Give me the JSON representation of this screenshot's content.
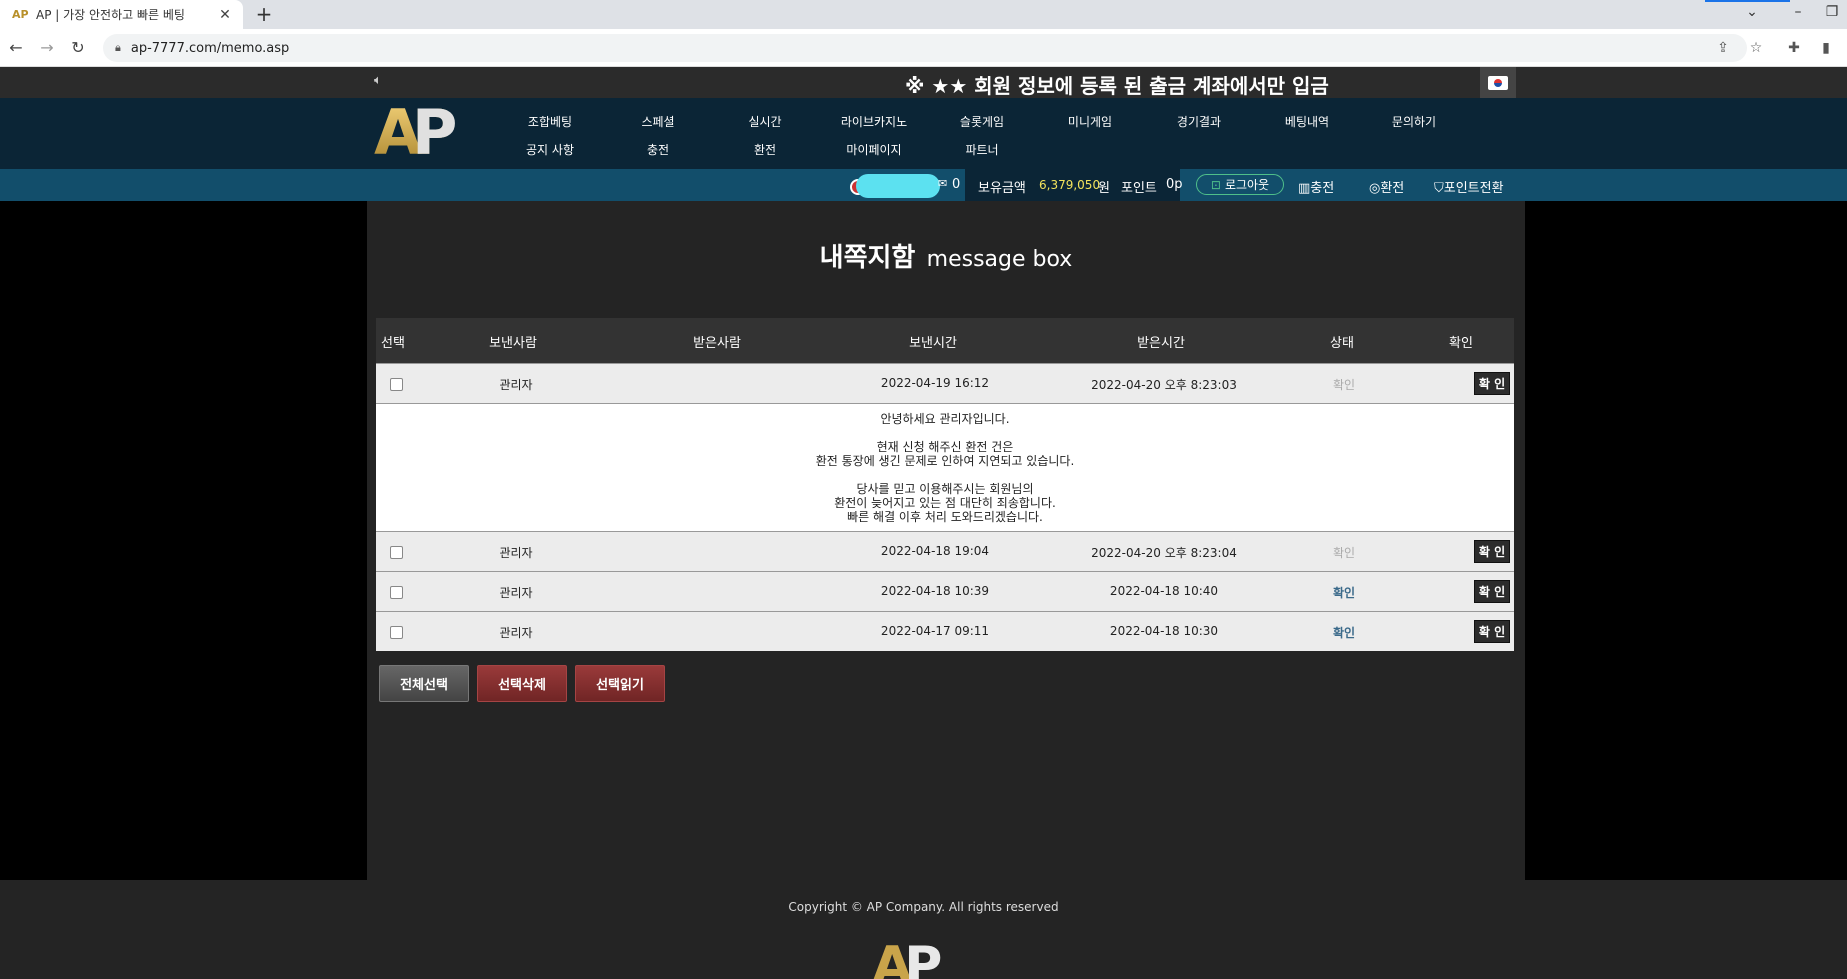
{
  "browser": {
    "tab_title": "AP | 가장 안전하고 빠른 베팅",
    "tab_close": "✕",
    "new_tab": "+",
    "url": "ap-7777.com/memo.asp"
  },
  "notice": {
    "text": "※ ★★ 회원 정보에 등록 된 출금 계좌에서만 입금"
  },
  "brand": {
    "logo_a": "A",
    "logo_p": "P"
  },
  "menu": {
    "row1": [
      "조합베팅",
      "스페셜",
      "실시간",
      "라이브카지노",
      "슬롯게임",
      "미니게임",
      "경기결과",
      "베팅내역",
      "문의하기"
    ],
    "row2": [
      "공지 사항",
      "충전",
      "환전",
      "마이페이지",
      "파트너"
    ]
  },
  "userbar": {
    "message_count": "0",
    "balance_label": "보유금액",
    "balance_value": "6,379,050",
    "balance_unit": "원",
    "point_label": "포인트",
    "point_value": "0p",
    "logout": "로그아웃",
    "deposit": "충전",
    "withdraw": "환전",
    "point_convert": "포인트전환"
  },
  "page": {
    "title_ko": "내쪽지함",
    "title_en": "message box"
  },
  "table": {
    "headers": [
      "선택",
      "보낸사람",
      "받은사람",
      "보낸시간",
      "받은시간",
      "상태",
      "확인"
    ],
    "rows": [
      {
        "sender": "관리자",
        "receiver": "",
        "sent": "2022-04-19 16:12",
        "received": "2022-04-20 오후 8:23:03",
        "status": "확인",
        "status_style": "muted",
        "button": "확 인"
      },
      {
        "sender": "관리자",
        "receiver": "",
        "sent": "2022-04-18 19:04",
        "received": "2022-04-20 오후 8:23:04",
        "status": "확인",
        "status_style": "muted",
        "button": "확 인"
      },
      {
        "sender": "관리자",
        "receiver": "",
        "sent": "2022-04-18 10:39",
        "received": "2022-04-18 10:40",
        "status": "확인",
        "status_style": "read",
        "button": "확 인"
      },
      {
        "sender": "관리자",
        "receiver": "",
        "sent": "2022-04-17 09:11",
        "received": "2022-04-18 10:30",
        "status": "확인",
        "status_style": "read",
        "button": "확 인"
      }
    ],
    "message_lines": [
      "안녕하세요 관리자입니다.",
      "",
      "현재 신청 해주신 환전 건은",
      "환전 통장에 생긴 문제로 인하여 지연되고 있습니다.",
      "",
      "당사를 믿고 이용해주시는 회원님의",
      "환전이 늦어지고 있는 점 대단히 죄송합니다.",
      "빠른 해결 이후 처리 도와드리겠습니다."
    ]
  },
  "actions": {
    "select_all": "전체선택",
    "delete_selected": "선택삭제",
    "read_selected": "선택읽기"
  },
  "footer": {
    "copyright": "Copyright © AP Company. All rights reserved"
  }
}
